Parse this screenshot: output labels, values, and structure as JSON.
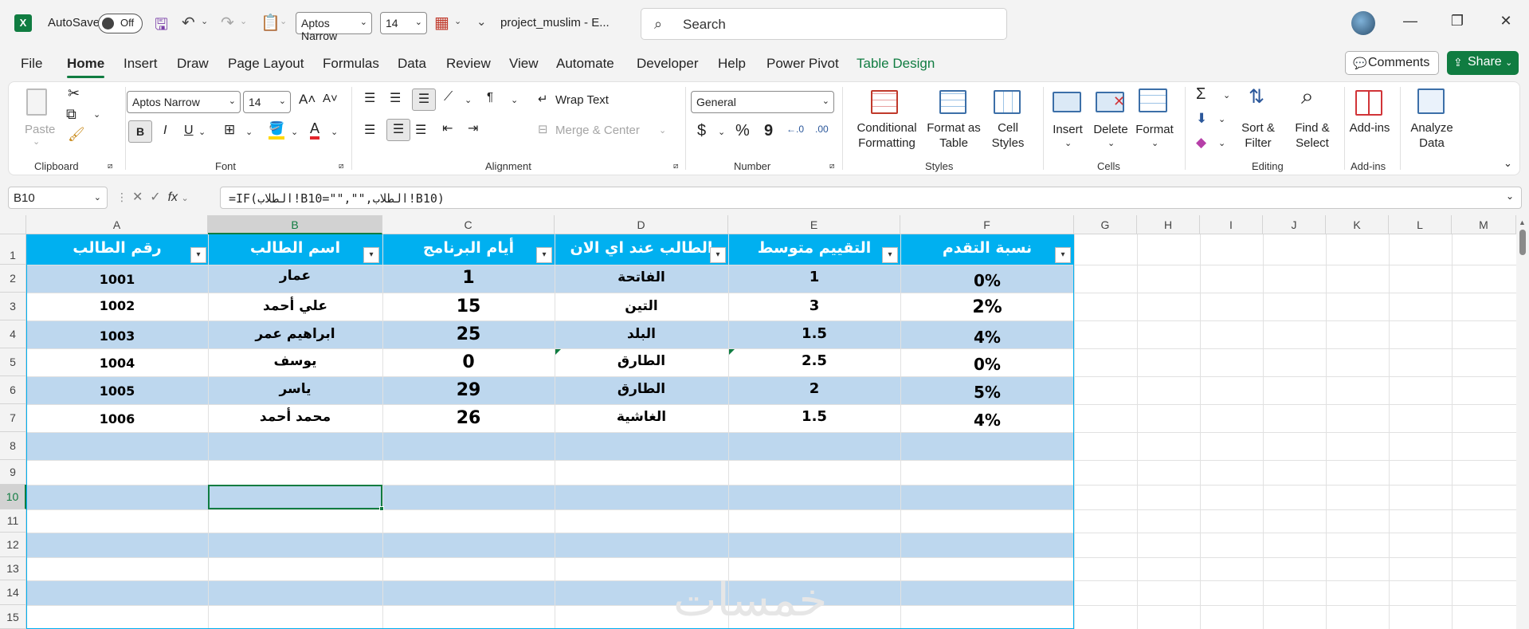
{
  "titlebar": {
    "autosave_label": "AutoSave",
    "autosave_state": "Off",
    "font_name": "Aptos Narrow",
    "font_size": "14",
    "doc_title": "project_muslim  -  E...",
    "search_placeholder": "Search",
    "minimize": "—",
    "restore": "❐",
    "close": "✕"
  },
  "tabs": [
    "File",
    "Home",
    "Insert",
    "Draw",
    "Page Layout",
    "Formulas",
    "Data",
    "Review",
    "View",
    "Automate",
    "Developer",
    "Help",
    "Power Pivot",
    "Table Design"
  ],
  "tab_buttons": {
    "comments": "Comments",
    "share": "Share"
  },
  "ribbon": {
    "clipboard": {
      "paste": "Paste",
      "label": "Clipboard"
    },
    "font": {
      "name": "Aptos Narrow",
      "size": "14",
      "bold": "B",
      "italic": "I",
      "underline": "U",
      "label": "Font"
    },
    "alignment": {
      "wrap_text": "Wrap Text",
      "merge_center": "Merge & Center",
      "label": "Alignment"
    },
    "number": {
      "format": "General",
      "currency": "$",
      "percent": "%",
      "comma": "9",
      "label": "Number"
    },
    "styles": {
      "conditional": [
        "Conditional",
        "Formatting"
      ],
      "format_table": [
        "Format as",
        "Table"
      ],
      "cell_styles": [
        "Cell",
        "Styles"
      ],
      "label": "Styles"
    },
    "cells": {
      "insert": "Insert",
      "delete": "Delete",
      "format": "Format",
      "label": "Cells"
    },
    "editing": {
      "sort_filter": [
        "Sort &",
        "Filter"
      ],
      "find_select": [
        "Find &",
        "Select"
      ],
      "label": "Editing"
    },
    "addins": {
      "addins": "Add-ins",
      "label": "Add-ins"
    },
    "analyze": [
      "Analyze",
      "Data"
    ]
  },
  "formula_bar": {
    "name_box": "B10",
    "fx": "fx",
    "formula": "=IF(الطلاب!B10=\"\",\"\",الطلاب!B10)"
  },
  "columns": [
    "A",
    "B",
    "C",
    "D",
    "E",
    "F",
    "G",
    "H",
    "I",
    "J",
    "K",
    "L",
    "M"
  ],
  "rows": [
    "1",
    "2",
    "3",
    "4",
    "5",
    "6",
    "7",
    "8",
    "9",
    "10",
    "11",
    "12",
    "13",
    "14",
    "15"
  ],
  "table": {
    "headers": [
      "رقم الطالب",
      "اسم الطالب",
      "أيام البرنامج",
      "الطالب عند اي الان",
      "التقييم متوسط",
      "نسبة التقدم"
    ],
    "rows": [
      [
        "1001",
        "عمار",
        "1",
        "الفاتحة",
        "1",
        "0%"
      ],
      [
        "1002",
        "علي أحمد",
        "15",
        "التين",
        "3",
        "2%"
      ],
      [
        "1003",
        "ابراهيم عمر",
        "25",
        "البلد",
        "1.5",
        "4%"
      ],
      [
        "1004",
        "يوسف",
        "0",
        "الطارق",
        "2.5",
        "0%"
      ],
      [
        "1005",
        "ياسر",
        "29",
        "الطارق",
        "2",
        "5%"
      ],
      [
        "1006",
        "محمد أحمد",
        "26",
        "الغاشية",
        "1.5",
        "4%"
      ]
    ]
  },
  "watermark": "خمسات",
  "colors": {
    "accent": "#107c41",
    "table_header": "#00b0f0",
    "band": "#bdd7ee"
  }
}
